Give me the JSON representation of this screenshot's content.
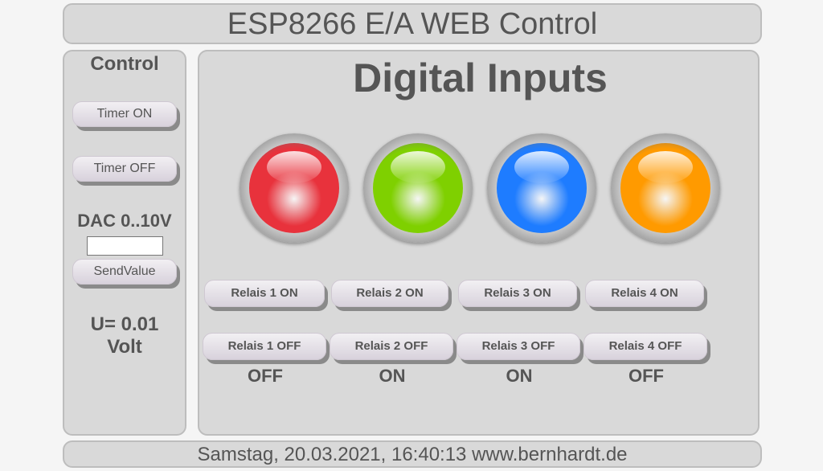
{
  "header": {
    "title": "ESP8266 E/A WEB Control"
  },
  "sidebar": {
    "title": "Control",
    "timer_on_label": "Timer ON",
    "timer_off_label": "Timer OFF",
    "dac_label": "DAC 0..10V",
    "dac_value": "",
    "send_label": "SendValue",
    "voltage_line1": "U= 0.01",
    "voltage_line2": "Volt"
  },
  "main": {
    "title": "Digital Inputs",
    "leds": [
      {
        "name": "red",
        "color": "#e8323c"
      },
      {
        "name": "green",
        "color": "#7fd000"
      },
      {
        "name": "blue",
        "color": "#1e7cff"
      },
      {
        "name": "orange",
        "color": "#ff9a00"
      }
    ],
    "relays": [
      {
        "on_label": "Relais 1 ON",
        "off_label": "Relais 1 OFF",
        "state": "OFF"
      },
      {
        "on_label": "Relais 2 ON",
        "off_label": "Relais 2 OFF",
        "state": "ON"
      },
      {
        "on_label": "Relais 3 ON",
        "off_label": "Relais 3 OFF",
        "state": "ON"
      },
      {
        "on_label": "Relais 4 ON",
        "off_label": "Relais 4 OFF",
        "state": "OFF"
      }
    ]
  },
  "footer": {
    "text": "Samstag, 20.03.2021, 16:40:13 www.bernhardt.de"
  }
}
